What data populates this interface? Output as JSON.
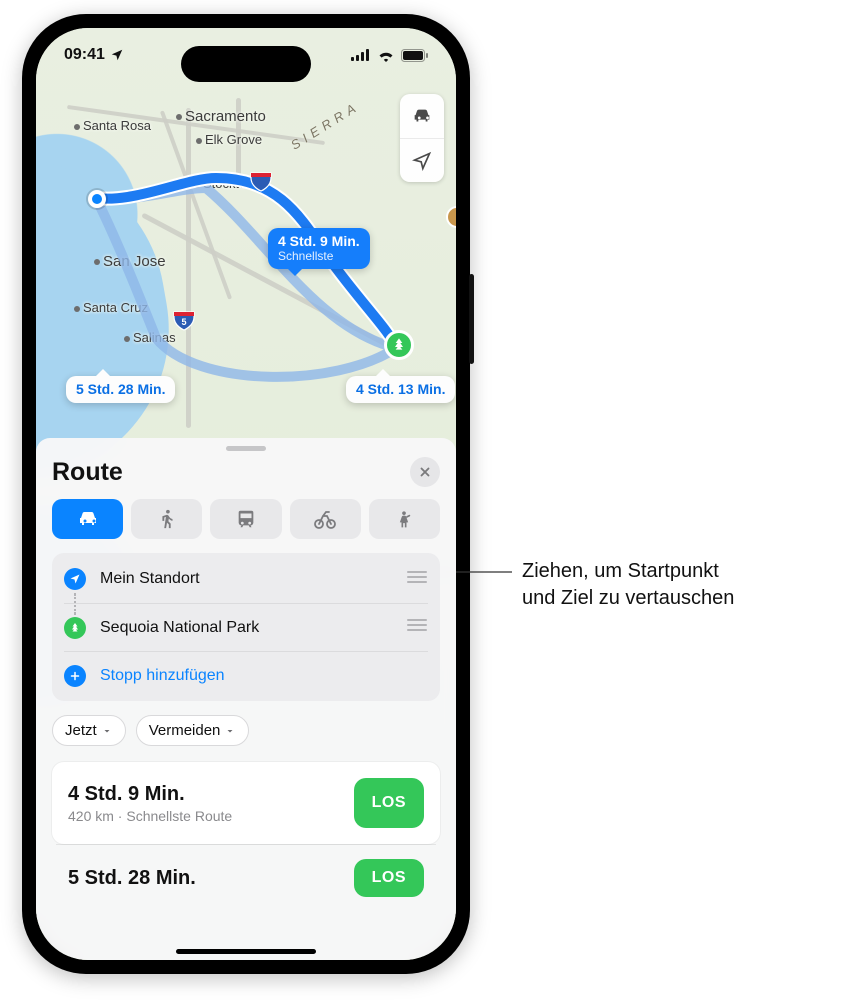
{
  "status": {
    "time": "09:41"
  },
  "map": {
    "cities": {
      "santaRosa": "Santa Rosa",
      "sacramento": "Sacramento",
      "elkGrove": "Elk Grove",
      "stockton": "Stockton",
      "sanJose": "San Jose",
      "santaCruz": "Santa Cruz",
      "salinas": "Salinas"
    },
    "mountains": {
      "sierra": "SIERRA"
    },
    "routeTips": {
      "primary": {
        "time": "4 Std. 9 Min.",
        "sub": "Schnellste"
      },
      "alt1": {
        "time": "5 Std. 28 Min."
      },
      "alt2": {
        "time": "4 Std. 13 Min."
      }
    }
  },
  "sheet": {
    "title": "Route",
    "stops": {
      "origin": "Mein Standort",
      "destination": "Sequoia National Park",
      "addStop": "Stopp hinzufügen"
    },
    "options": {
      "now": "Jetzt",
      "avoid": "Vermeiden"
    },
    "results": [
      {
        "time": "4 Std. 9 Min.",
        "meta": "420 km · Schnellste Route",
        "go": "LOS"
      },
      {
        "time": "5 Std. 28 Min.",
        "meta": "",
        "go": "LOS"
      }
    ]
  },
  "callout": {
    "line1": "Ziehen, um Startpunkt",
    "line2": "und Ziel zu vertauschen"
  }
}
